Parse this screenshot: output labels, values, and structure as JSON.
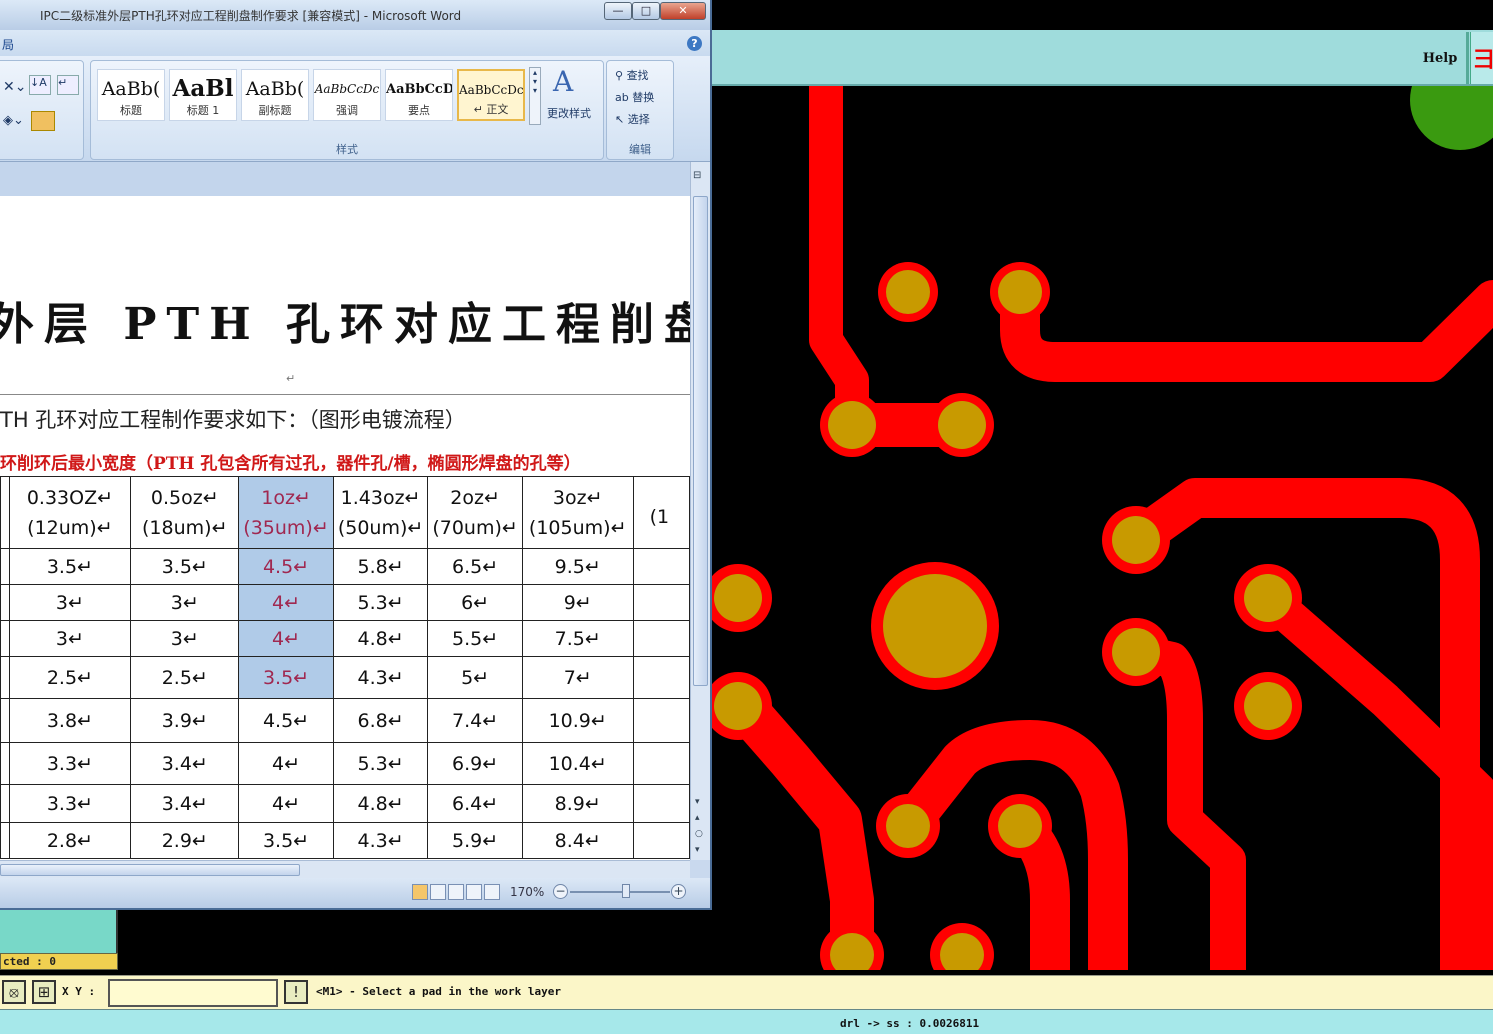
{
  "word": {
    "title": "IPC二级标准外层PTH孔环对应工程削盘制作要求 [兼容模式] - Microsoft Word",
    "menu_fragment": "局",
    "help_glyph": "?",
    "controls": {
      "minimize": "—",
      "maximize": "□",
      "close": "✕"
    },
    "ribbon": {
      "styles": [
        {
          "sample": "AaBb(",
          "name": "标题"
        },
        {
          "sample": "AaBl",
          "name": "标题 1"
        },
        {
          "sample": "AaBb(",
          "name": "副标题"
        },
        {
          "sample": "AaBbCcDc",
          "name": "强调"
        },
        {
          "sample": "AaBbCcD",
          "name": "要点"
        },
        {
          "sample": "AaBbCcDc",
          "name": "↵ 正文"
        }
      ],
      "change_styles": "更改样式",
      "styles_group": "样式",
      "find": "查找",
      "replace": "替换",
      "select": "选择",
      "edit_group": "编辑"
    },
    "doc": {
      "title": "外层 PTH 孔环对应工程削盘",
      "subtitle": "TH 孔环对应工程制作要求如下：（图形电镀流程）",
      "note": "环削环后最小宽度（PTH 孔包含所有过孔，器件孔/槽，椭圆形焊盘的孔等）",
      "para_mark": "↵",
      "table_header": [
        [
          "0.33OZ↵",
          "(12um)↵"
        ],
        [
          "0.5oz↵",
          "(18um)↵"
        ],
        [
          "1oz↵",
          "(35um)↵"
        ],
        [
          "1.43oz↵",
          "(50um)↵"
        ],
        [
          "2oz↵",
          "(70um)↵"
        ],
        [
          "3oz↵",
          "(105um)↵"
        ],
        [
          "",
          "(1"
        ]
      ],
      "table_rows": [
        [
          "3.5↵",
          "3.5↵",
          "4.5↵",
          "5.8↵",
          "6.5↵",
          "9.5↵",
          ""
        ],
        [
          "3↵",
          "3↵",
          "4↵",
          "5.3↵",
          "6↵",
          "9↵",
          ""
        ],
        [
          "3↵",
          "3↵",
          "4↵",
          "4.8↵",
          "5.5↵",
          "7.5↵",
          ""
        ],
        [
          "2.5↵",
          "2.5↵",
          "3.5↵",
          "4.3↵",
          "5↵",
          "7↵",
          ""
        ],
        [
          "3.8↵",
          "3.9↵",
          "4.5↵",
          "6.8↵",
          "7.4↵",
          "10.9↵",
          ""
        ],
        [
          "3.3↵",
          "3.4↵",
          "4↵",
          "5.3↵",
          "6.9↵",
          "10.4↵",
          ""
        ],
        [
          "3.3↵",
          "3.4↵",
          "4↵",
          "4.8↵",
          "6.4↵",
          "8.9↵",
          ""
        ],
        [
          "2.8↵",
          "2.9↵",
          "3.5↵",
          "4.3↵",
          "5.9↵",
          "8.4↵",
          ""
        ]
      ]
    },
    "status": {
      "zoom": "170%",
      "zoom_level_percent": 170
    }
  },
  "cad": {
    "help": "Help",
    "corner_glyph": "彐",
    "selected": "cted : 0",
    "xy_label": "X Y :",
    "xy_value": "",
    "message": "<M1> - Select a pad in the work layer",
    "drl": "drl -> ss : 0.0026811",
    "colors": {
      "trace": "#ff0000",
      "pad": "#c89a00",
      "bg": "#000000",
      "green": "#3a9a10",
      "panel": "#9fdcdc"
    }
  }
}
